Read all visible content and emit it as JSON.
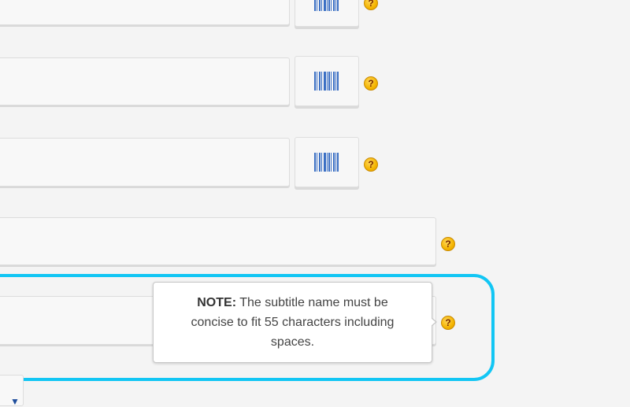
{
  "form": {
    "rows": [
      {
        "input_value": "",
        "has_barcode": true
      },
      {
        "input_value": "",
        "has_barcode": true
      },
      {
        "input_value": "",
        "has_barcode": true
      },
      {
        "input_value": "",
        "has_barcode": false
      },
      {
        "input_value": "",
        "has_barcode": false
      }
    ],
    "help_symbol": "?",
    "barcode_icon": "barcode-icon",
    "help_icon": "help-icon"
  },
  "tooltip": {
    "prefix": "NOTE:",
    "text": "The subtitle name must be concise to fit 55 characters including spaces."
  },
  "language_select": {
    "chevron_icon": "chevron-down-icon"
  },
  "colors": {
    "highlight": "#12c6f4",
    "help_icon": "#f4b400",
    "barcode": "#3a6fc4"
  }
}
